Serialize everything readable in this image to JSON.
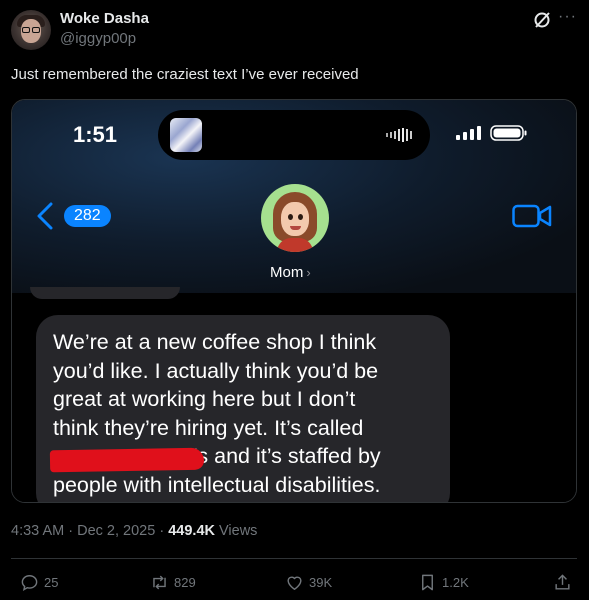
{
  "tweet": {
    "author_name": "Woke Dasha",
    "author_handle": "@iggyp00p",
    "text": "Just remembered the craziest text I’ve ever received",
    "time": "4:33 AM",
    "separator": "·",
    "date": "Dec 2, 2025",
    "views_count": "449.4K",
    "views_label": "Views"
  },
  "phone": {
    "clock": "1:51",
    "unread_count": "282",
    "contact_name": "Mom",
    "contact_chevron": "›",
    "message_lines": [
      "We’re at a new coffee shop I think",
      "you’d like. I actually think you’d be",
      "great at working here but I don’t",
      "think they’re hiring yet. It’s called",
      "",
      "people with intellectual disabilities."
    ],
    "message_line5_visible": "’s and it’s staffed by"
  },
  "actions": {
    "replies": "25",
    "reposts": "829",
    "likes": "39K",
    "bookmarks": "1.2K"
  },
  "icons": {
    "grok": "grok-icon",
    "more": "more-icon",
    "reply": "reply-icon",
    "repost": "repost-icon",
    "like": "heart-icon",
    "bookmark": "bookmark-icon",
    "share": "share-icon"
  },
  "colors": {
    "background": "#000000",
    "text": "#e7e9ea",
    "muted": "#71767b",
    "imessage_blue": "#0a84ff",
    "bubble": "#26262a",
    "redaction": "#e0101b"
  }
}
